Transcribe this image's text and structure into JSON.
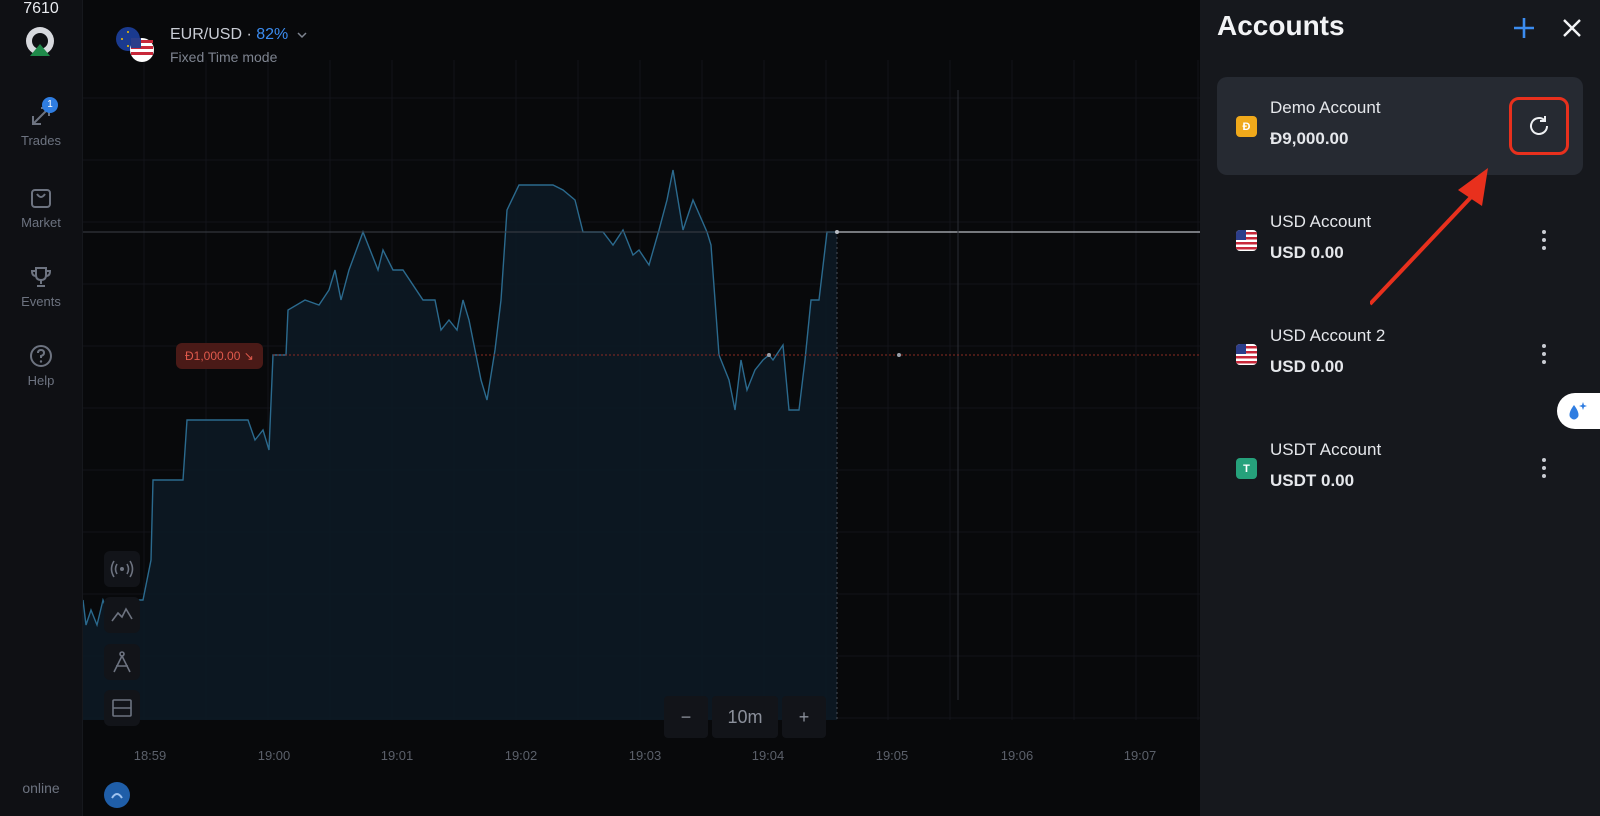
{
  "nav": {
    "items": [
      {
        "label": "Trades",
        "badge": "1",
        "icon": "trades-icon"
      },
      {
        "label": "Market",
        "icon": "bag-icon"
      },
      {
        "label": "Events",
        "icon": "trophy-icon"
      },
      {
        "label": "Help",
        "icon": "help-icon"
      }
    ],
    "online_count": "7610",
    "online_label": "online"
  },
  "asset": {
    "pair": "EUR/USD",
    "separator": " · ",
    "payout": "82%",
    "mode": "Fixed Time mode"
  },
  "chart": {
    "trade_label": "Đ1,000.00 ↘",
    "time_labels": [
      "18:59",
      "19:00",
      "19:01",
      "19:02",
      "19:03",
      "19:04",
      "19:05",
      "19:06",
      "19:07"
    ],
    "zoom": {
      "minus": "−",
      "value": "10m",
      "plus": "+"
    },
    "colors": {
      "line": "#2b6a8e",
      "trade_line": "#8a2a22",
      "price_line": "#b9bdc4"
    }
  },
  "panel": {
    "title": "Accounts",
    "accounts": [
      {
        "name": "Demo Account",
        "balance": "Đ9,000.00",
        "icon_text": "Đ",
        "icon_color": "#f0a91b",
        "active": true,
        "action": "refresh-icon"
      },
      {
        "name": "USD Account",
        "balance": "USD 0.00",
        "icon": "us-flag-icon",
        "action": "more-icon"
      },
      {
        "name": "USD Account 2",
        "balance": "USD 0.00",
        "icon": "us-flag-icon",
        "action": "more-icon"
      },
      {
        "name": "USDT Account",
        "balance": "USDT 0.00",
        "icon_text": "T",
        "icon_color": "#26a17b",
        "action": "more-icon"
      }
    ],
    "highlight_color": "#e8301d"
  }
}
